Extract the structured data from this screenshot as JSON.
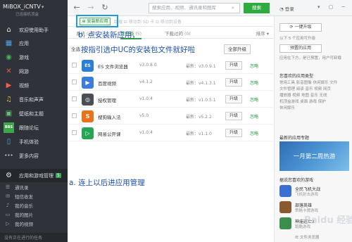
{
  "app": {
    "title": "MiBOX_iCNTV",
    "device_label": "已连接机顶盒"
  },
  "sidebar": {
    "items": [
      {
        "icon": "home-icon",
        "label": "欢迎使用助手",
        "glyph": "⌂"
      },
      {
        "icon": "app-icon",
        "label": "应用",
        "glyph": "▦"
      },
      {
        "icon": "game-icon",
        "label": "游戏",
        "glyph": "◉"
      },
      {
        "icon": "tools-icon",
        "label": "网游",
        "glyph": "✕"
      },
      {
        "icon": "video-icon",
        "label": "视频",
        "glyph": "▶"
      },
      {
        "icon": "music-icon",
        "label": "音乐和声声",
        "glyph": "♫"
      },
      {
        "icon": "wallpaper-icon",
        "label": "壁纸和主题",
        "glyph": "▣"
      },
      {
        "icon": "forum-icon",
        "label": "跟随论坛",
        "glyph": "BBS"
      },
      {
        "icon": "phone-icon",
        "label": "手机体验",
        "glyph": "▯"
      },
      {
        "icon": "more-icon",
        "label": "更多内容",
        "glyph": "•••"
      }
    ],
    "manage_item": {
      "label": "应用和游戏管理",
      "badge": "5",
      "glyph": "⚙"
    },
    "sub_items": [
      {
        "icon": "contacts-icon",
        "label": "通讯录"
      },
      {
        "icon": "sms-icon",
        "label": "短信收发"
      },
      {
        "icon": "music-icon",
        "label": "我的音乐"
      },
      {
        "icon": "image-icon",
        "label": "我的图片"
      },
      {
        "icon": "video-icon",
        "label": "我的视频"
      }
    ],
    "footer": "没有正在进行的任务"
  },
  "topbar": {
    "back": "←",
    "forward": "→",
    "refresh": "↻",
    "search_placeholder": "搜索应用、视频、通讯录和图库",
    "search_button": "搜索",
    "login": "登录",
    "window_controls": "▾ ▢ ─ ✕"
  },
  "toolbar": {
    "install_button": "安装新应用",
    "items": "卸载  ⊟ 移动到 SD 卡  ⊟ 移动到设备"
  },
  "annotations": {
    "b": "b. 点安装新应用，",
    "c": "按指引选中UC的安装包文件就好啦",
    "a": "a. 连上以后进应用管理"
  },
  "tabs": [
    {
      "label": "系统",
      "count": "(32)",
      "active": false
    },
    {
      "label": "可升级",
      "count": "(5)",
      "active": true
    },
    {
      "label": "下载过的",
      "count": "(0)",
      "active": false
    }
  ],
  "sort_label": "排序 ▾",
  "list_header": {
    "select_all": "全选",
    "update_all": "全部升级"
  },
  "apps": [
    {
      "name": "ES 文件浏览器",
      "version": "v3.0.8.0",
      "latest": "最新：v3.0.9.1",
      "update": "升级",
      "ignore": "忽略",
      "icon": "es-file-explorer-icon",
      "color": "#2a7fd4",
      "glyph": "ES"
    },
    {
      "name": "百度视频",
      "version": "v4.1.2",
      "latest": "最新：v4.1.3.1",
      "update": "升级",
      "ignore": "忽略",
      "icon": "baidu-video-icon",
      "color": "#3b7dd8",
      "glyph": "▶"
    },
    {
      "name": "授权管理",
      "version": "v1.0.4",
      "latest": "最新：v1.0.5.1",
      "update": "升级",
      "ignore": "忽略",
      "icon": "permission-manager-icon",
      "color": "#4a4f56",
      "glyph": "◎"
    },
    {
      "name": "搜狗输入法",
      "version": "v5.0",
      "latest": "最新：v5.2.2",
      "update": "升级",
      "ignore": "忽略",
      "icon": "sogou-input-icon",
      "color": "#e8731b",
      "glyph": "S"
    },
    {
      "name": "网易公开课",
      "version": "v1.0.4",
      "latest": "最新：v1.1.0",
      "update": "升级",
      "ignore": "忽略",
      "icon": "netease-open-course-icon",
      "color": "#27a455",
      "glyph": "▷"
    }
  ],
  "right_panel": {
    "one_key_update": "一键升级",
    "update_hint": "以下 5 个应用可升级",
    "pre_install_button": "预置的应用",
    "pre_install_hint": "应用在下方，是已预置，用户可卸载",
    "categories_head": "您喜欢的应用类型",
    "categories": [
      "常用工具 影音图像 休闲娱乐 文件",
      "文件管理 阅读 音乐 视频 网页",
      "播放器 视频 地图 音乐 无线",
      "机顶盒游戏 桌面 游戏 保护",
      "休闲娱乐"
    ],
    "topics_head": "最新的应用专题",
    "banner": "一月第二周热游",
    "recommend_head": "据说您喜欢的游戏",
    "games": [
      {
        "name": "全民飞机大战",
        "sub": "飞机射击游戏",
        "color": "#3c6fd2"
      },
      {
        "name": "部落英雄",
        "sub": "策略卡牌游戏",
        "color": "#8a5a2e"
      },
      {
        "name": "神庙逃亡2",
        "sub": "跑酷游戏",
        "color": "#3a8f4a"
      }
    ],
    "more_games": "IE 文件浏览器"
  },
  "watermark": "Baidu 经验"
}
